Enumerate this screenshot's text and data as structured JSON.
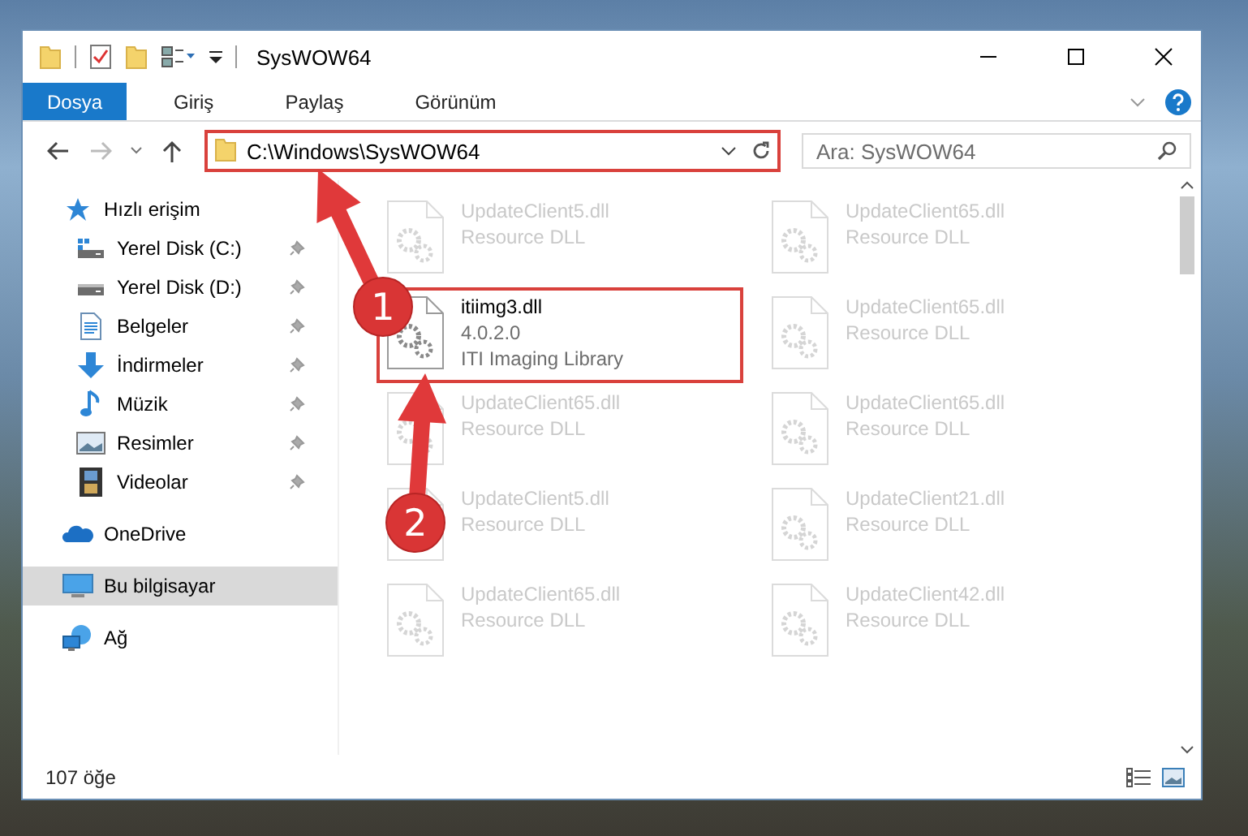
{
  "window": {
    "title": "SysWOW64"
  },
  "ribbon_tabs": [
    {
      "label": "Dosya",
      "selected": true
    },
    {
      "label": "Giriş",
      "selected": false
    },
    {
      "label": "Paylaş",
      "selected": false
    },
    {
      "label": "Görünüm",
      "selected": false
    }
  ],
  "address_bar": {
    "path": "C:\\Windows\\SysWOW64"
  },
  "search": {
    "placeholder": "Ara: SysWOW64"
  },
  "navigation": [
    {
      "label": "Hızlı erişim",
      "kind": "quick-access",
      "selected": false,
      "children": [
        {
          "label": "Yerel Disk (C:)",
          "kind": "system-drive",
          "pinned": true,
          "selected": false
        },
        {
          "label": "Yerel Disk (D:)",
          "kind": "drive",
          "pinned": true,
          "selected": false
        },
        {
          "label": "Belgeler",
          "kind": "documents",
          "pinned": true,
          "selected": false
        },
        {
          "label": "İndirmeler",
          "kind": "downloads",
          "pinned": true,
          "selected": false
        },
        {
          "label": "Müzik",
          "kind": "music",
          "pinned": true,
          "selected": false
        },
        {
          "label": "Resimler",
          "kind": "pictures",
          "pinned": true,
          "selected": false
        },
        {
          "label": "Videolar",
          "kind": "videos",
          "pinned": true,
          "selected": false
        }
      ]
    },
    {
      "label": "OneDrive",
      "kind": "cloud",
      "selected": false
    },
    {
      "label": "Bu bilgisayar",
      "kind": "computer",
      "selected": true
    },
    {
      "label": "Ağ",
      "kind": "network",
      "selected": false
    }
  ],
  "files": [
    {
      "name": "UpdateClient5.dll",
      "details": [
        "Resource DLL"
      ],
      "faded": true
    },
    {
      "name": "UpdateClient65.dll",
      "details": [
        "Resource DLL"
      ],
      "faded": true
    },
    {
      "name": "itiimg3.dll",
      "details": [
        "4.0.2.0",
        "ITI Imaging Library"
      ],
      "faded": false
    },
    {
      "name": "UpdateClient65.dll",
      "details": [
        "Resource DLL"
      ],
      "faded": true
    },
    {
      "name": "UpdateClient65.dll",
      "details": [
        "Resource DLL"
      ],
      "faded": true
    },
    {
      "name": "UpdateClient65.dll",
      "details": [
        "Resource DLL"
      ],
      "faded": true
    },
    {
      "name": "UpdateClient5.dll",
      "details": [
        "Resource DLL"
      ],
      "faded": true
    },
    {
      "name": "UpdateClient21.dll",
      "details": [
        "Resource DLL"
      ],
      "faded": true
    },
    {
      "name": "UpdateClient65.dll",
      "details": [
        "Resource DLL"
      ],
      "faded": true
    },
    {
      "name": "UpdateClient42.dll",
      "details": [
        "Resource DLL"
      ],
      "faded": true
    }
  ],
  "status_bar": {
    "item_count": "107 öğe"
  },
  "annotations": [
    {
      "label": "1"
    },
    {
      "label": "2"
    }
  ]
}
